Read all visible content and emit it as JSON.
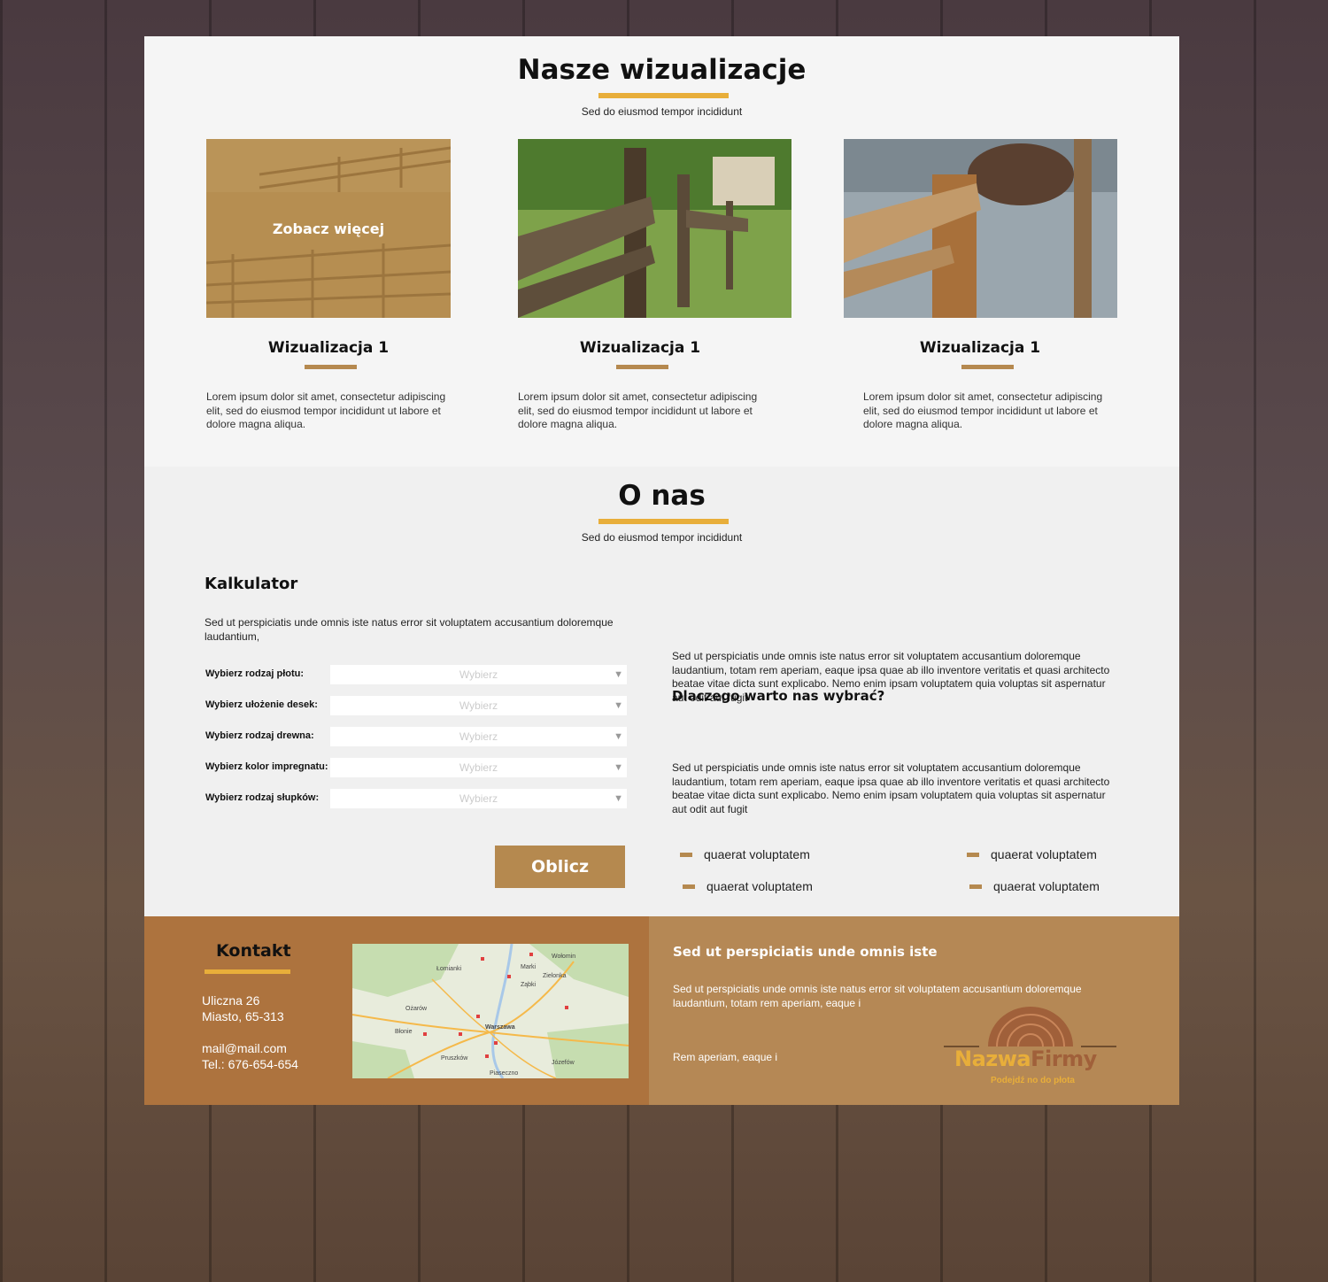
{
  "visualizations": {
    "title": "Nasze wizualizacje",
    "subtitle": "Sed do eiusmod tempor incididunt",
    "cards": [
      {
        "title": "Wizualizacja 1",
        "overlay": "Zobacz więcej",
        "text": "Lorem ipsum dolor sit amet, consectetur adipiscing elit, sed do eiusmod tempor incididunt ut labore et dolore magna aliqua."
      },
      {
        "title": "Wizualizacja 1",
        "text": "Lorem ipsum dolor sit amet, consectetur adipiscing elit, sed do eiusmod tempor incididunt ut labore et dolore magna aliqua."
      },
      {
        "title": "Wizualizacja 1",
        "text": "Lorem ipsum dolor sit amet, consectetur adipiscing elit, sed do eiusmod tempor incididunt ut labore et dolore magna aliqua."
      }
    ]
  },
  "about": {
    "title": "O nas",
    "subtitle": "Sed do eiusmod tempor incididunt",
    "text1": "Sed ut perspiciatis unde omnis iste natus error sit voluptatem accusantium doloremque laudantium, totam rem aperiam, eaque ipsa quae ab illo inventore veritatis et quasi architecto beatae vitae dicta sunt explicabo. Nemo enim ipsam voluptatem quia voluptas sit aspernatur aut odit aut fugit",
    "why_title": "Dlaczego warto nas wybrać?",
    "text2": "Sed ut perspiciatis unde omnis iste natus error sit voluptatem accusantium doloremque laudantium, totam rem aperiam, eaque ipsa quae ab illo inventore veritatis et quasi architecto beatae vitae dicta sunt explicabo. Nemo enim ipsam voluptatem quia voluptas sit aspernatur aut odit aut fugit",
    "bullets": [
      "quaerat voluptatem",
      "quaerat voluptatem",
      "quaerat voluptatem",
      "quaerat voluptatem"
    ]
  },
  "calculator": {
    "title": "Kalkulator",
    "description": "Sed ut perspiciatis unde omnis iste natus error sit voluptatem accusantium doloremque laudantium,",
    "fields": [
      {
        "label": "Wybierz rodzaj płotu:",
        "value": "Wybierz"
      },
      {
        "label": "Wybierz ułożenie desek:",
        "value": "Wybierz"
      },
      {
        "label": "Wybierz rodzaj drewna:",
        "value": "Wybierz"
      },
      {
        "label": "Wybierz kolor impregnatu:",
        "value": "Wybierz"
      },
      {
        "label": "Wybierz rodzaj słupków:",
        "value": "Wybierz"
      }
    ],
    "button": "Oblicz"
  },
  "contact": {
    "title": "Kontakt",
    "street": "Uliczna 26",
    "city": "Miasto,  65-313",
    "email": "mail@mail.com",
    "phone": "Tel.: 676-654-654",
    "map_labels": [
      "Warszawa",
      "Pruszków",
      "Marki",
      "Ząbki",
      "Zielonka",
      "Wołomin",
      "Józefów",
      "Błonie",
      "Łomianki",
      "Ożarów",
      "Piaseczno"
    ]
  },
  "footer_right": {
    "title": "Sed ut perspiciatis unde omnis iste",
    "text": "Sed ut perspiciatis unde omnis iste natus error sit  voluptatem accusantium doloremque laudantium, totam  rem aperiam, eaque i",
    "small": "Rem aperiam, eaque i",
    "logo_part1": "Nazwa",
    "logo_part2": "Firmy",
    "logo_tagline": "Podejdź no do płota"
  },
  "colors": {
    "accent": "#e8ae3a",
    "brown": "#b5894f",
    "footer_left": "#ad733e",
    "footer_right": "#b58855"
  }
}
